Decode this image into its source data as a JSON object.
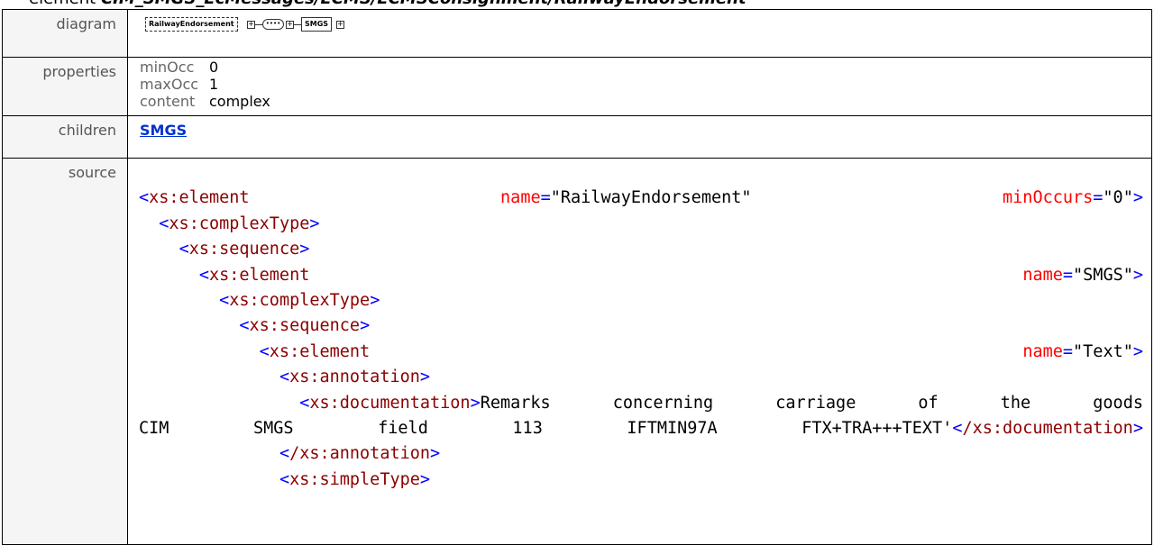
{
  "header": {
    "prefix": "element",
    "path": "CIM_SMGS_EcMessages/ECMS/ECMSConsignment/RailwayEndorsement"
  },
  "rows": {
    "diagram": {
      "label": "diagram"
    },
    "properties": {
      "label": "properties"
    },
    "children": {
      "label": "children"
    },
    "source": {
      "label": "source"
    }
  },
  "diagram": {
    "element_name": "RailwayEndorsement",
    "sequence_symbol": "••••",
    "child_name": "SMGS"
  },
  "properties": [
    {
      "key": "minOcc",
      "value": "0"
    },
    {
      "key": "maxOcc",
      "value": "1"
    },
    {
      "key": "content",
      "value": "complex"
    }
  ],
  "children": [
    "SMGS"
  ],
  "source": {
    "l1": {
      "tag": "xs:element",
      "attr1": "name",
      "val1": "\"RailwayEndorsement\"",
      "attr2": "minOccurs",
      "val2": "\"0\""
    },
    "l2": {
      "tag": "xs:complexType"
    },
    "l3": {
      "tag": "xs:sequence"
    },
    "l4": {
      "tag": "xs:element",
      "attr": "name",
      "val": "\"SMGS\""
    },
    "l5": {
      "tag": "xs:complexType"
    },
    "l6": {
      "tag": "xs:sequence"
    },
    "l7": {
      "tag": "xs:element",
      "attr": "name",
      "val": "\"Text\""
    },
    "l8": {
      "tag": "xs:annotation"
    },
    "l9": {
      "tag": "xs:documentation",
      "text_a": "Remarks concerning carriage of the goods"
    },
    "l10": {
      "words": [
        "CIM",
        "SMGS",
        "field",
        "113",
        "IFTMIN97A",
        "FTX+TRA+++TEXT'"
      ],
      "close_tag": "/xs:documentation"
    },
    "l11": {
      "tag": "/xs:annotation"
    },
    "l12": {
      "tag": "xs:simpleType"
    }
  }
}
